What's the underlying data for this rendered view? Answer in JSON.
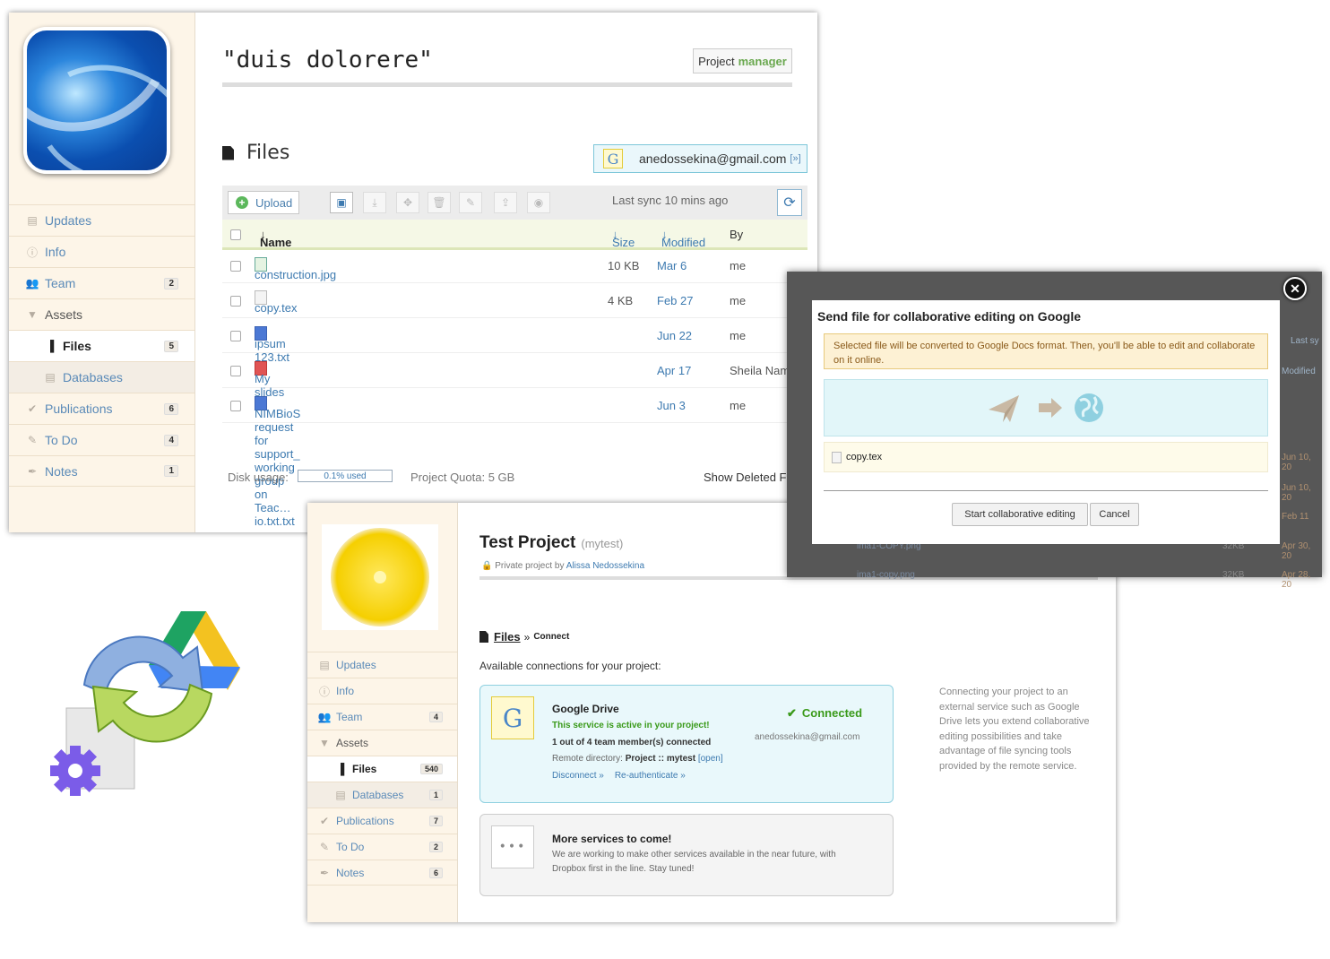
{
  "window1": {
    "project_title": "\"duis dolorere\"",
    "role_label": "Project",
    "role_value": "manager",
    "files_heading": "Files",
    "account": {
      "email": "anedossekina@gmail.com",
      "ext": "[»]",
      "icon": "google-g-icon"
    },
    "toolbar": {
      "upload_label": "Upload",
      "sync_text": "Last sync 10 mins ago"
    },
    "sidebar": {
      "items": [
        {
          "label": "Updates",
          "icon": "updates-icon",
          "count": ""
        },
        {
          "label": "Info",
          "icon": "info-icon",
          "count": ""
        },
        {
          "label": "Team",
          "icon": "team-icon",
          "count": "2"
        },
        {
          "label": "Assets",
          "icon": "chevron-down-icon",
          "count": ""
        },
        {
          "label": "Files",
          "icon": "file-icon",
          "count": "5"
        },
        {
          "label": "Databases",
          "icon": "database-icon",
          "count": ""
        },
        {
          "label": "Publications",
          "icon": "publications-icon",
          "count": "6"
        },
        {
          "label": "To Do",
          "icon": "todo-icon",
          "count": "4"
        },
        {
          "label": "Notes",
          "icon": "notes-icon",
          "count": "1"
        }
      ]
    },
    "table": {
      "headers": {
        "name": "Name",
        "size": "Size",
        "modified": "Modified",
        "by": "By"
      },
      "rows": [
        {
          "name": "construction.jpg",
          "size": "10 KB",
          "modified": "Mar 6",
          "by": "me",
          "type": "img"
        },
        {
          "name": "copy.tex",
          "size": "4 KB",
          "modified": "Feb 27",
          "by": "me",
          "type": "tex"
        },
        {
          "name": "ipsum 123.txt",
          "size": "",
          "modified": "Jun 22",
          "by": "me",
          "type": "doc"
        },
        {
          "name": "My slides",
          "size": "",
          "modified": "Apr 17",
          "by": "Sheila Nam",
          "type": "sl"
        },
        {
          "name": "NIMBioS request for support_ working group on Teac…io.txt.txt",
          "size": "",
          "modified": "Jun 3",
          "by": "me",
          "type": "doc"
        }
      ]
    },
    "footer": {
      "disk_label": "Disk usage:",
      "disk_value": "0.1% used",
      "quota": "Project Quota: 5 GB",
      "show_deleted": "Show Deleted F"
    }
  },
  "dialog": {
    "title": "Send file for collaborative editing on Google",
    "warning": "Selected file will be converted to Google Docs format. Then, you'll be able to edit and collaborate on it online.",
    "file": "copy.tex",
    "start_button": "Start collaborative editing",
    "cancel_button": "Cancel",
    "bg_text": [
      "Last sy",
      "Modified",
      "Jun 10, 20",
      "Jun 10, 20",
      "Feb 11",
      "ima1-COPY.png",
      "32KB",
      "Apr 30, 20",
      "ima1-copy.png",
      "32KB",
      "Apr 28, 20"
    ]
  },
  "window2": {
    "title": "Test Project",
    "slug": "(mytest)",
    "privacy": "Private project by",
    "owner": "Alissa Nedossekina",
    "crumb_files": "Files",
    "crumb_sep": "»",
    "crumb_connect": "Connect",
    "available": "Available connections for your project:",
    "sidebar": {
      "items": [
        {
          "label": "Updates",
          "icon": "updates-icon",
          "count": ""
        },
        {
          "label": "Info",
          "icon": "info-icon",
          "count": ""
        },
        {
          "label": "Team",
          "icon": "team-icon",
          "count": "4"
        },
        {
          "label": "Assets",
          "icon": "chevron-down-icon",
          "count": ""
        },
        {
          "label": "Files",
          "icon": "file-icon",
          "count": "540"
        },
        {
          "label": "Databases",
          "icon": "database-icon",
          "count": "1"
        },
        {
          "label": "Publications",
          "icon": "publications-icon",
          "count": "7"
        },
        {
          "label": "To Do",
          "icon": "todo-icon",
          "count": "2"
        },
        {
          "label": "Notes",
          "icon": "notes-icon",
          "count": "6"
        }
      ]
    },
    "google": {
      "name": "Google Drive",
      "active": "This service is active in your project!",
      "members": "1 out of 4 team member(s) connected",
      "remote_label": "Remote directory:",
      "remote_value": "Project :: mytest",
      "open": "[open]",
      "disconnect": "Disconnect »",
      "reauth": "Re-authenticate »",
      "status": "Connected",
      "email": "anedossekina@gmail.com"
    },
    "more": {
      "title": "More services to come!",
      "text1": "We are working to make other services available in the near future, with",
      "text2": "Dropbox first in the line. Stay tuned!"
    },
    "description": "Connecting your project to an external service such as Google Drive lets you extend collaborative editing possibilities and take advantage of file syncing tools provided by the remote service."
  },
  "colors": {
    "link": "#3d7ab0",
    "accent_green": "#6aa84f",
    "sidebar_bg": "#fdf5e8"
  }
}
